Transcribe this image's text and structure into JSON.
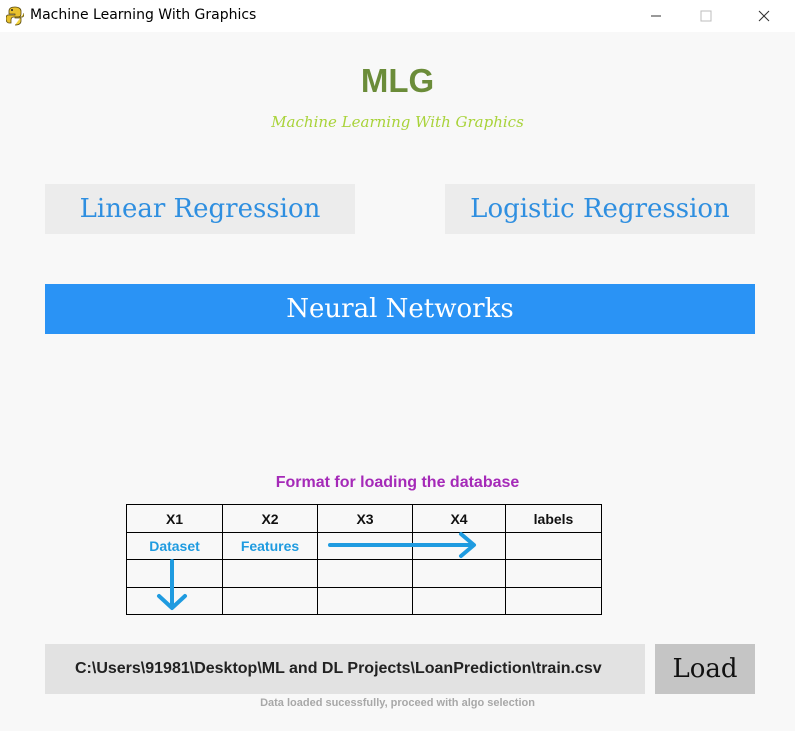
{
  "window": {
    "title": "Machine Learning With Graphics",
    "app_icon": "python-snake-icon",
    "controls": [
      "minimize-icon",
      "maximize-icon",
      "close-icon"
    ]
  },
  "header": {
    "title": "MLG",
    "subtitle": "Machine Learning With Graphics"
  },
  "algorithms": {
    "linear_label": "Linear Regression",
    "logistic_label": "Logistic Regression",
    "neural_label": "Neural Networks"
  },
  "format": {
    "title": "Format for loading the database",
    "headers": [
      "X1",
      "X2",
      "X3",
      "X4",
      "labels"
    ],
    "row1": [
      "Dataset",
      "Features",
      "",
      "",
      ""
    ],
    "annotation_arrows": [
      "right-arrow-icon",
      "down-arrow-icon"
    ]
  },
  "loader": {
    "path_value": "C:\\Users\\91981\\Desktop\\ML and DL Projects\\LoanPrediction\\train.csv",
    "load_label": "Load",
    "status": "Data loaded sucessfully, proceed with algo selection"
  },
  "colors": {
    "title_green": "#6b8c39",
    "subtitle_green": "#a9d33a",
    "algo_text_blue": "#2f8fe0",
    "neural_bg_blue": "#2a93f5",
    "format_title_purple": "#a52ab8",
    "arrow_blue": "#1f9be0"
  }
}
